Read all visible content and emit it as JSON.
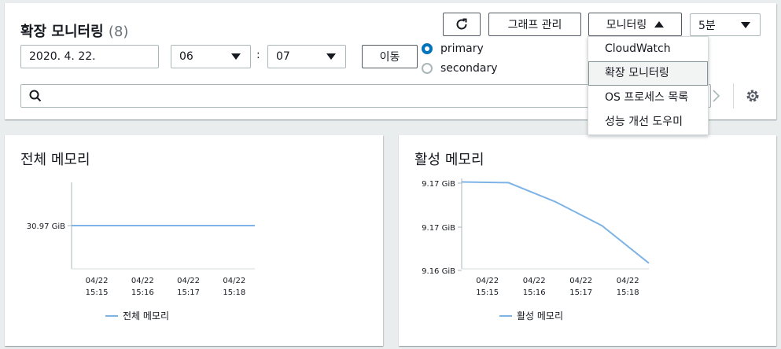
{
  "header": {
    "title": "확장 모니터링",
    "count": "(8)",
    "graph_manage_label": "그래프 관리",
    "monitoring_label": "모니터링",
    "interval_value": "5분"
  },
  "controls": {
    "date_value": "2020. 4. 22.",
    "hour_value": "06",
    "colon": ":",
    "minute_value": "07",
    "go_label": "이동",
    "radio_primary": "primary",
    "radio_secondary": "secondary",
    "selected_instance": "primary"
  },
  "monitoring_menu": {
    "items": [
      "CloudWatch",
      "확장 모니터링",
      "OS 프로세스 목록",
      "성능 개선 도우미"
    ],
    "highlighted_index": 1
  },
  "chart_data": [
    {
      "type": "line",
      "title": "전체 메모리",
      "x": [
        "04/22 15:15",
        "04/22 15:16",
        "04/22 15:17",
        "04/22 15:18"
      ],
      "yticks": [
        "30.97 GiB"
      ],
      "series": [
        {
          "name": "전체 메모리",
          "values": [
            30.97,
            30.97,
            30.97,
            30.97,
            30.97
          ],
          "color": "#7eb3e6"
        }
      ]
    },
    {
      "type": "line",
      "title": "활성 메모리",
      "x": [
        "04/22 15:15",
        "04/22 15:16",
        "04/22 15:17",
        "04/22 15:18"
      ],
      "yticks": [
        "9.17 GiB",
        "9.17 GiB",
        "9.16 GiB"
      ],
      "series": [
        {
          "name": "활성 메모리",
          "values": [
            9.17,
            9.1699,
            9.1672,
            9.1638,
            9.1585
          ],
          "color": "#7eb3e6"
        }
      ]
    }
  ]
}
